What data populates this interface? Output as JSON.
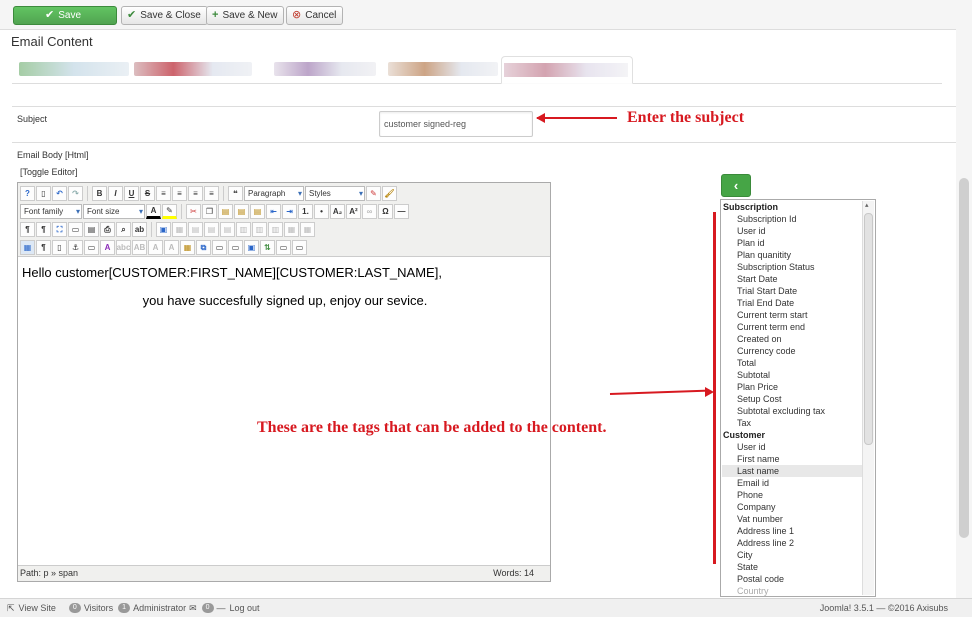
{
  "toolbar": {
    "save": "Save",
    "save_close": "Save & Close",
    "save_new": "Save & New",
    "cancel": "Cancel"
  },
  "section_title": "Email Content",
  "colors": {
    "accent_green": "#51a351",
    "annotation_red": "#d71920"
  },
  "subject": {
    "label": "Subject",
    "value": "customer signed-reg"
  },
  "body": {
    "label": "Email Body [Html]",
    "toggle_editor": "[Toggle Editor]"
  },
  "editor": {
    "format_select": "Paragraph",
    "styles_select": "Styles",
    "font_family_select": "Font family",
    "font_size_select": "Font size",
    "line1": "Hello customer[CUSTOMER:FIRST_NAME][CUSTOMER:LAST_NAME],",
    "line2": "you have succesfully signed up, enjoy our sevice.",
    "path_label": "Path:",
    "path_value": "p » span",
    "words_label": "Words:",
    "words_value": "14"
  },
  "annotations": {
    "subject_note": "Enter the subject",
    "tags_note": "These are the tags that can be added to the content."
  },
  "tags": {
    "groups": [
      {
        "name": "Subscription",
        "items": [
          "Subscription Id",
          "User id",
          "Plan id",
          "Plan quanitity",
          "Subscription Status",
          "Start Date",
          "Trial Start Date",
          "Trial End Date",
          "Current term start",
          "Current term end",
          "Created on",
          "Currency code",
          "Total",
          "Subtotal",
          "Plan Price",
          "Setup Cost",
          "Subtotal excluding tax",
          "Tax"
        ]
      },
      {
        "name": "Customer",
        "items": [
          "User id",
          "First name",
          "Last name",
          "Email id",
          "Phone",
          "Company",
          "Vat number",
          "Address line 1",
          "Address line 2",
          "City",
          "State",
          "Postal code",
          "Country"
        ]
      }
    ],
    "highlighted": "Last name"
  },
  "footer": {
    "view_site": "View Site",
    "visitors_count": "0",
    "visitors": "Visitors",
    "admin_count": "1",
    "administrator": "Administrator",
    "messages_count": "0",
    "logout": "Log out",
    "version": "Joomla! 3.5.1 — ©2016 Axisubs"
  }
}
